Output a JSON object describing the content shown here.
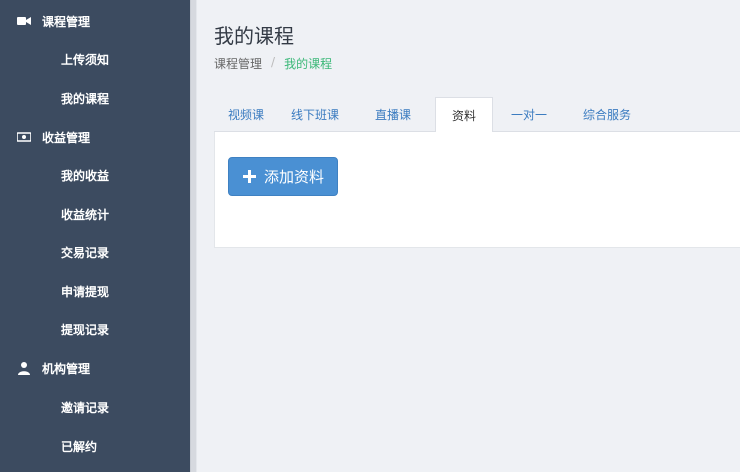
{
  "sidebar": {
    "groups": [
      {
        "label": "课程管理",
        "icon": "video-camera-icon",
        "items": [
          "上传须知",
          "我的课程"
        ]
      },
      {
        "label": "收益管理",
        "icon": "money-icon",
        "items": [
          "我的收益",
          "收益统计",
          "交易记录",
          "申请提现",
          "提现记录"
        ]
      },
      {
        "label": "机构管理",
        "icon": "user-icon",
        "items": [
          "邀请记录",
          "已解约"
        ]
      }
    ]
  },
  "page": {
    "title": "我的课程",
    "breadcrumb": {
      "parent": "课程管理",
      "separator": "/",
      "current": "我的课程"
    }
  },
  "tabs": [
    "视频课",
    "线下班课",
    "直播课",
    "资料",
    "一对一",
    "综合服务"
  ],
  "active_tab": "资料",
  "panel": {
    "add_button_label": "添加资料"
  },
  "colors": {
    "sidebar_bg": "#3c4b60",
    "accent_blue": "#4a90d3",
    "breadcrumb_active": "#3bb878",
    "tab_link": "#3a7bc0"
  }
}
